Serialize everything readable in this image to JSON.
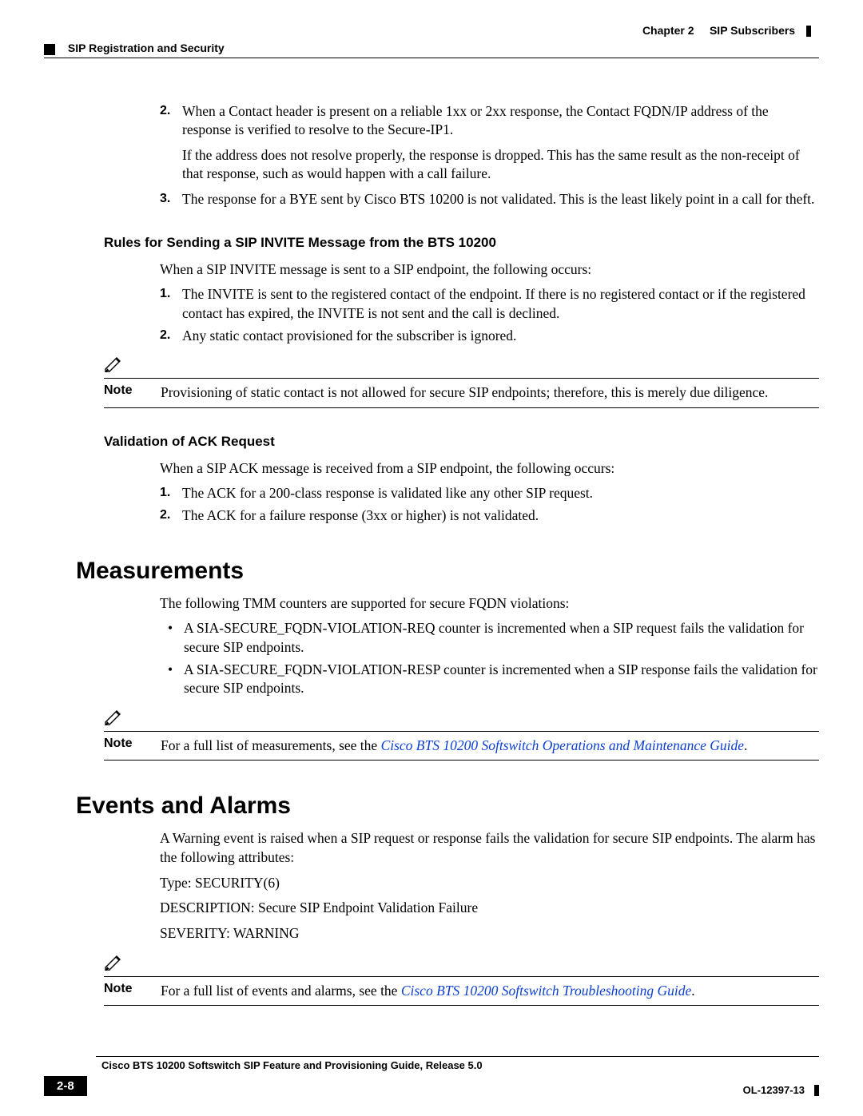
{
  "header": {
    "chapter_label": "Chapter 2",
    "chapter_title": "SIP Subscribers",
    "section_title": "SIP Registration and Security"
  },
  "body": {
    "item2_a": "When a Contact header is present on a reliable 1xx or 2xx response, the Contact FQDN/IP address of the response is verified to resolve to the Secure-IP1.",
    "item2_b": "If the address does not resolve properly, the response is dropped. This has the same result as the non-receipt of that response, such as would happen with a call failure.",
    "item3": "The response for a BYE sent by Cisco BTS 10200 is not validated. This is the least likely point in a call for theft.",
    "rules_h": "Rules for Sending a SIP INVITE Message from the BTS 10200",
    "rules_intro": "When a SIP INVITE message is sent to a SIP endpoint, the following occurs:",
    "rules_1": "The INVITE is sent to the registered contact of the endpoint. If there is no registered contact or if the registered contact has expired, the INVITE is not sent and the call is declined.",
    "rules_2": "Any static contact provisioned for the subscriber is ignored.",
    "note1": "Provisioning of static contact is not allowed for secure SIP endpoints; therefore, this is merely due diligence.",
    "ack_h": "Validation of ACK Request",
    "ack_intro": "When a SIP ACK message is received from a SIP endpoint, the following occurs:",
    "ack_1": "The ACK for a 200-class response is validated like any other SIP request.",
    "ack_2": "The ACK for a failure response (3xx or higher) is not validated.",
    "meas_h": "Measurements",
    "meas_intro": "The following TMM counters are supported for secure FQDN violations:",
    "meas_b1": "A SIA-SECURE_FQDN-VIOLATION-REQ counter is incremented when a SIP request fails the validation for secure SIP endpoints.",
    "meas_b2": "A SIA-SECURE_FQDN-VIOLATION-RESP counter is incremented when a SIP response fails the validation for secure SIP endpoints.",
    "note2_pre": "For a full list of measurements, see the ",
    "note2_link": "Cisco BTS 10200 Softswitch Operations and Maintenance Guide",
    "events_h": "Events and Alarms",
    "events_intro": "A Warning event is raised when a SIP request or response fails the validation for secure SIP endpoints. The alarm has the following attributes:",
    "type_line": "Type: SECURITY(6)",
    "desc_line": "DESCRIPTION: Secure SIP Endpoint Validation Failure",
    "sev_line": "SEVERITY: WARNING",
    "note3_pre": "For a full list of events and alarms, see the ",
    "note3_link": "Cisco BTS 10200 Softswitch Troubleshooting Guide",
    "note_label": "Note"
  },
  "footer": {
    "book_title": "Cisco BTS 10200 Softswitch SIP Feature and Provisioning Guide, Release 5.0",
    "page_num": "2-8",
    "doc_id": "OL-12397-13"
  }
}
